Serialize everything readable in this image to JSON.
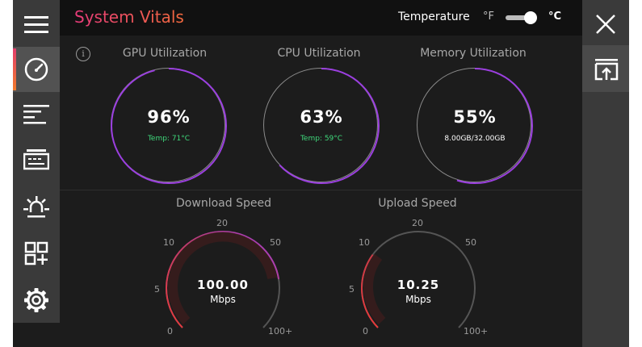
{
  "header": {
    "title": "System Vitals",
    "temperature_label": "Temperature",
    "unit_f": "°F",
    "unit_c": "°C",
    "selected_unit": "°C"
  },
  "info_icon": "i",
  "gauges": [
    {
      "title": "GPU Utilization",
      "value": "96%",
      "sub": "Temp: 71°C",
      "percent": 96
    },
    {
      "title": "CPU Utilization",
      "value": "63%",
      "sub": "Temp: 59°C",
      "percent": 63
    },
    {
      "title": "Memory Utilization",
      "value": "55%",
      "sub": "8.00GB/32.00GB",
      "percent": 55
    }
  ],
  "speeds": [
    {
      "title": "Download Speed",
      "value": "100.00",
      "unit": "Mbps",
      "ticks": [
        "0",
        "5",
        "10",
        "20",
        "50",
        "100+"
      ],
      "fill_fraction": 0.8
    },
    {
      "title": "Upload Speed",
      "value": "10.25",
      "unit": "Mbps",
      "ticks": [
        "0",
        "5",
        "10",
        "20",
        "50",
        "100+"
      ],
      "fill_fraction": 0.3
    }
  ],
  "sidebar": {
    "items": [
      "menu-icon",
      "speedometer-icon",
      "list-icon",
      "memory-icon",
      "lighting-icon",
      "apps-icon",
      "settings-icon"
    ],
    "active": "speedometer-icon"
  },
  "right_sidebar": {
    "items": [
      "close-icon",
      "window-upload-icon"
    ]
  },
  "colors": {
    "accent_start": "#e63b7a",
    "accent_end": "#f36a3e",
    "ring_purple": "#9b3fe0",
    "temp_green": "#3fd97b"
  }
}
